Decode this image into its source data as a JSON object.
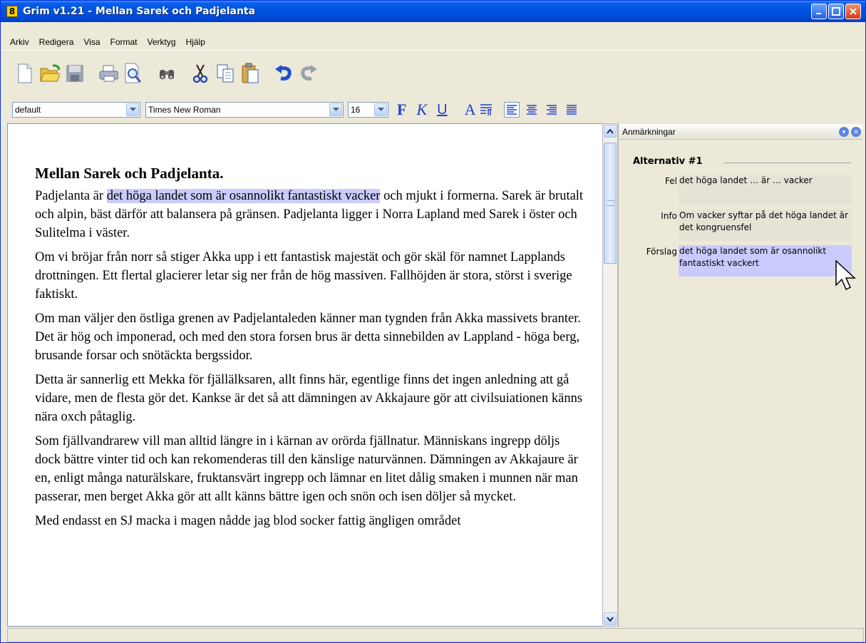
{
  "window": {
    "title": "Grim v1.21 - Mellan Sarek och Padjelanta",
    "icon_letter": "8"
  },
  "menu": [
    "Arkiv",
    "Redigera",
    "Visa",
    "Format",
    "Verktyg",
    "Hjälp"
  ],
  "toolbar_icons": [
    "new-document-icon",
    "open-folder-icon",
    "save-icon",
    "print-icon",
    "print-preview-icon",
    "find-icon",
    "cut-icon",
    "copy-icon",
    "paste-icon",
    "undo-icon",
    "redo-icon"
  ],
  "format": {
    "style": "default",
    "font": "Times New Roman",
    "size": "16",
    "bold": "F",
    "italic": "K",
    "underline": "U",
    "color": "A"
  },
  "document": {
    "heading": "Mellan Sarek och Padjelanta.",
    "p1_before": "Padjelanta är ",
    "p1_highlight": "det höga landet som är osannolikt fantastiskt vacker",
    "p1_after": " och mjukt i formerna. Sarek är brutalt och alpin, bäst därför att balansera på gränsen. Padjelanta ligger i Norra Lapland med Sarek i öster och Sulitelma i väster.",
    "p2": "Om vi bröjar från norr så stiger Akka upp i ett fantastisk majestät och gör skäl för namnet Lapplands drottningen. Ett flertal glacierer letar sig ner från de hög massiven. Fallhöjden är stora, störst i sverige faktiskt.",
    "p3": "Om man väljer den östliga grenen av Padjelantaleden känner man tygnden från Akka massivets branter. Det är hög och imponerad, och med den stora forsen brus är detta sinnebilden av Lappland - höga berg, brusande forsar och snötäckta bergssidor.",
    "p4": "Detta är sannerlig ett Mekka för fjällälksaren, allt finns här, egentlige finns det ingen anledning att gå vidare, men de flesta gör det. Kankse är det så att dämningen av Akkajaure gör att civilsuiationen känns nära oxch påtaglig.",
    "p5": "Som fjällvandrarew vill man alltid längre in i kärnan av orörda fjällnatur. Människans ingrepp döljs dock bättre vinter tid och kan rekomenderas till den känslige naturvännen. Dämningen av Akkajaure är en, enligt många naturälskare, fruktansvärt ingrepp och lämnar en litet dålig smaken i munnen när man passerar, men berget Akka gör att allt känns bättre igen och snön och isen döljer så mycket.",
    "p6": "Med endasst en SJ macka i magen nådde jag blod socker fattig ängligen området"
  },
  "panel": {
    "title": "Anmärkningar",
    "alt_title": "Alternativ #1",
    "fel_label": "Fel",
    "fel_value": "det höga landet  … är  … vacker",
    "info_label": "Info",
    "info_value": "Om vacker syftar på det höga landet är det kongruensfel",
    "forslag_label": "Förslag",
    "forslag_value": "det höga landet som är osannolikt fantastiskt vackert"
  }
}
